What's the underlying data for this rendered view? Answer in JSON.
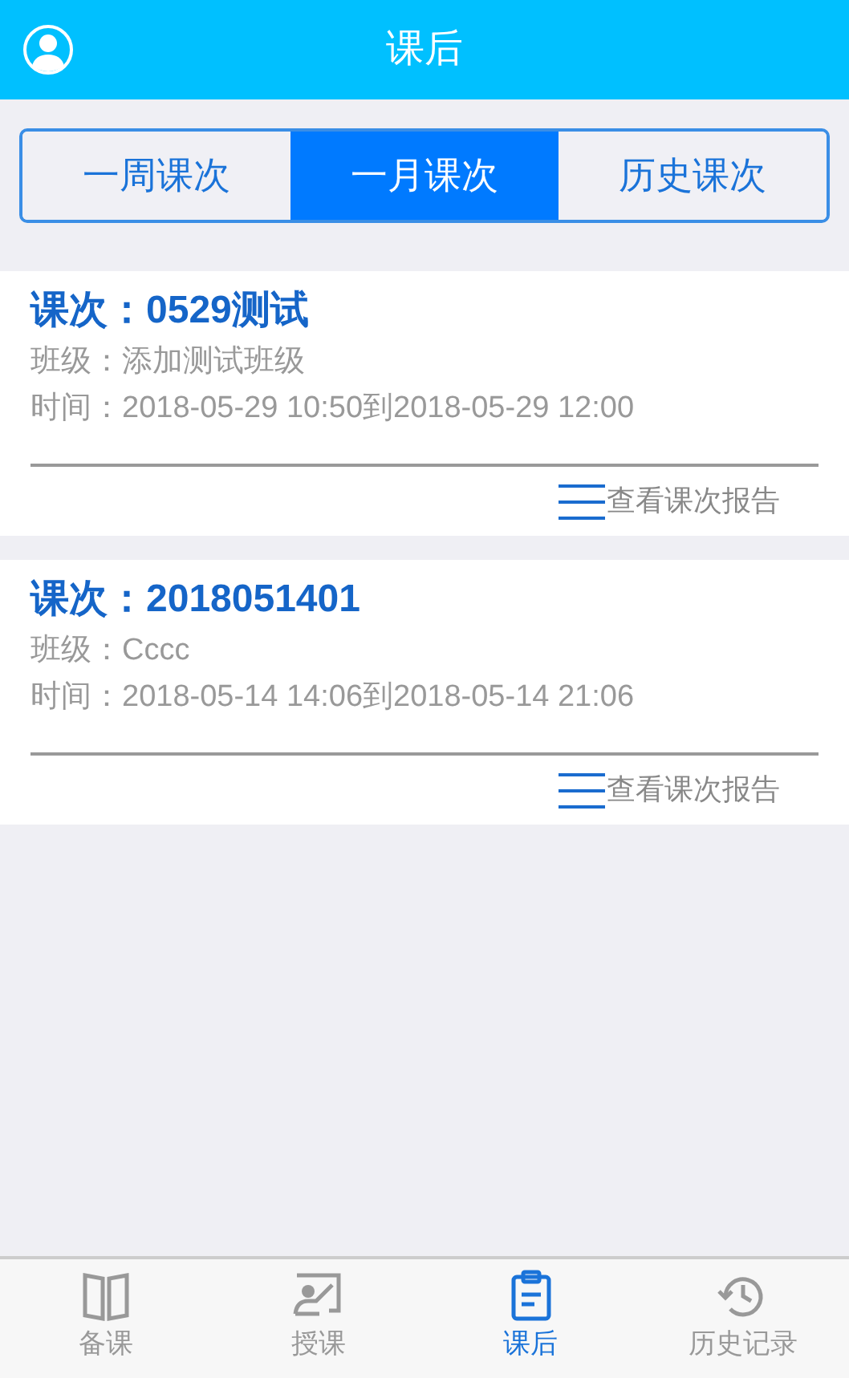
{
  "header": {
    "title": "课后"
  },
  "tabs": [
    {
      "label": "一周课次",
      "selected": false
    },
    {
      "label": "一月课次",
      "selected": true
    },
    {
      "label": "历史课次",
      "selected": false
    }
  ],
  "lessons": [
    {
      "title": "课次：0529测试",
      "class_label": "班级：",
      "class_value": "添加测试班级",
      "time_label": "时间：",
      "time_value": "2018-05-29 10:50到2018-05-29 12:00",
      "report_link": "查看课次报告"
    },
    {
      "title": "课次：2018051401",
      "class_label": "班级：",
      "class_value": "Cccc",
      "time_label": "时间：",
      "time_value": "2018-05-14 14:06到2018-05-14 21:06",
      "report_link": "查看课次报告"
    }
  ],
  "bottom_nav": [
    {
      "kind": "book",
      "label": "备课",
      "selected": false
    },
    {
      "kind": "teach",
      "label": "授课",
      "selected": false
    },
    {
      "kind": "clipboard",
      "label": "课后",
      "selected": true
    },
    {
      "kind": "history",
      "label": "历史记录",
      "selected": false
    }
  ]
}
